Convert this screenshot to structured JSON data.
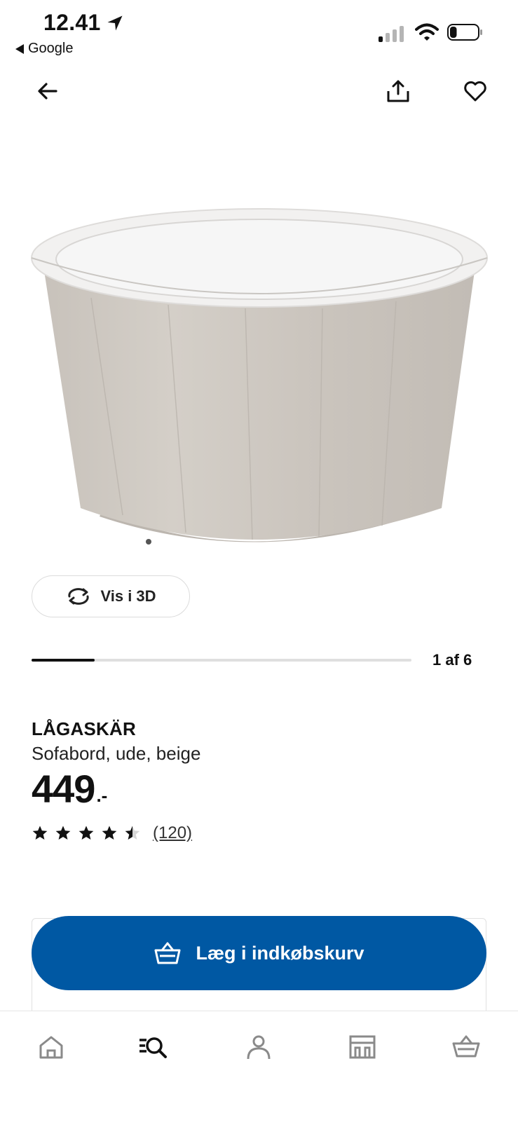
{
  "status_bar": {
    "time": "12.41",
    "back_app_label": "Google",
    "location_icon": "location-arrow-icon",
    "signal_icon": "cellular-signal-icon",
    "wifi_icon": "wifi-icon",
    "battery_icon": "battery-icon",
    "battery_level": 0.25
  },
  "top_nav": {
    "back_icon": "arrow-left-icon",
    "share_icon": "share-icon",
    "favorite_icon": "heart-icon"
  },
  "gallery": {
    "view_3d_label": "Vis i 3D",
    "view_3d_icon": "rotate-3d-icon",
    "position_label": "1 af 6",
    "current_index": 1,
    "total_images": 6
  },
  "product": {
    "name": "LÅGASKÄR",
    "description": "Sofabord, ude, beige",
    "price_main": "449",
    "price_suffix": ".-",
    "rating_value": 4.5,
    "rating_max": 5,
    "rating_count": "(120)"
  },
  "cta": {
    "label": "Læg i indkøbskurv",
    "icon": "basket-icon",
    "color": "#0058a3"
  },
  "tab_bar": {
    "items": [
      {
        "icon": "home-icon"
      },
      {
        "icon": "search-list-icon",
        "active": true
      },
      {
        "icon": "profile-icon"
      },
      {
        "icon": "store-icon"
      },
      {
        "icon": "basket-icon"
      }
    ]
  },
  "colors": {
    "accent": "#0058a3",
    "text": "#111111",
    "inactive_icon": "#8a8a8a"
  }
}
